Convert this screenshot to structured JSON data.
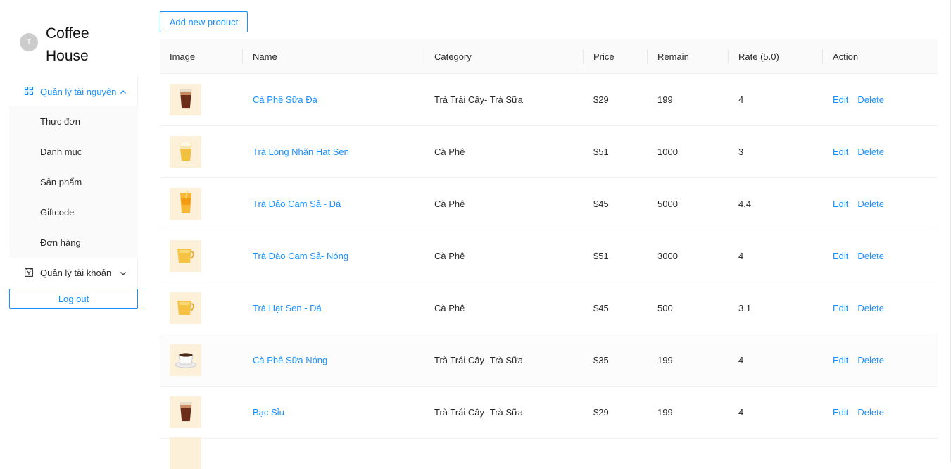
{
  "brand": {
    "avatar_letter": "T",
    "name": "Coffee House"
  },
  "menu": {
    "group1": {
      "label": "Quản lý tài nguyên",
      "items": [
        "Thực đơn",
        "Danh mục",
        "Sản phẩm",
        "Giftcode",
        "Đơn hàng"
      ]
    },
    "group2": {
      "label": "Quản lý tài khoản"
    },
    "logout": "Log out"
  },
  "toolbar": {
    "add_label": "Add new product"
  },
  "table": {
    "columns": [
      "Image",
      "Name",
      "Category",
      "Price",
      "Remain",
      "Rate (5.0)",
      "Action"
    ],
    "rows": [
      {
        "image": "iced-coffee-icon",
        "name": "Cà Phê Sữa Đá",
        "category": "Trà Trái Cây- Trà Sữa",
        "price": "$29",
        "remain": "199",
        "rate": "4",
        "edit": "Edit",
        "delete": "Delete"
      },
      {
        "image": "lotus-tea-icon",
        "name": "Trà Long Nhãn Hạt Sen",
        "category": "Cà Phê",
        "price": "$51",
        "remain": "1000",
        "rate": "3",
        "edit": "Edit",
        "delete": "Delete"
      },
      {
        "image": "peach-tea-icon",
        "name": "Trà Đảo Cam Sả - Đá",
        "category": "Cà Phê",
        "price": "$45",
        "remain": "5000",
        "rate": "4.4",
        "edit": "Edit",
        "delete": "Delete"
      },
      {
        "image": "hot-tea-icon",
        "name": "Trà Đào Cam Sả- Nóng",
        "category": "Cà Phê",
        "price": "$51",
        "remain": "3000",
        "rate": "4",
        "edit": "Edit",
        "delete": "Delete"
      },
      {
        "image": "hot-tea-icon",
        "name": "Trà Hạt Sen - Đá",
        "category": "Cà Phê",
        "price": "$45",
        "remain": "500",
        "rate": "3.1",
        "edit": "Edit",
        "delete": "Delete"
      },
      {
        "image": "hot-coffee-cup-icon",
        "name": "Cà Phê Sữa Nóng",
        "category": "Trà Trái Cây- Trà Sữa",
        "price": "$35",
        "remain": "199",
        "rate": "4",
        "edit": "Edit",
        "delete": "Delete"
      },
      {
        "image": "iced-coffee-icon",
        "name": "Bạc Sỉu",
        "category": "Trà Trái Cây- Trà Sữa",
        "price": "$29",
        "remain": "199",
        "rate": "4",
        "edit": "Edit",
        "delete": "Delete"
      }
    ]
  },
  "colors": {
    "accent": "#1890ff",
    "thumb_bg": "#fdf0d8"
  }
}
